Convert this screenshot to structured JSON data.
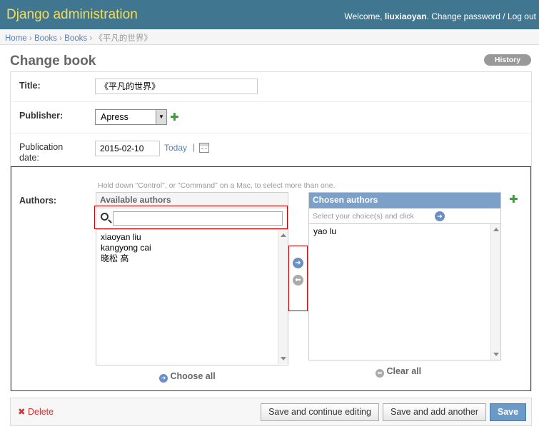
{
  "header": {
    "branding": "Django administration",
    "welcome": "Welcome, ",
    "username": "liuxiaoyan",
    "change_password": "Change password",
    "separator": " / ",
    "logout": "Log out"
  },
  "breadcrumbs": {
    "home": "Home",
    "app": "Books",
    "model": "Books",
    "current": "《平凡的世界》",
    "sep": "›"
  },
  "page": {
    "title": "Change book",
    "history": "History"
  },
  "form": {
    "title_label": "Title:",
    "title_value": "《平凡的世界》",
    "publisher_label": "Publisher:",
    "publisher_value": "Apress",
    "pubdate_label_1": "Publication",
    "pubdate_label_2": "date:",
    "pubdate_value": "2015-02-10",
    "today": "Today",
    "today_sep": "|",
    "authors_label": "Authors:",
    "help_text": "Hold down \"Control\", or \"Command\" on a Mac, to select more than one."
  },
  "available": {
    "title": "Available authors",
    "filter_value": "",
    "items": [
      "xiaoyan liu",
      "kangyong cai",
      "晓松 高"
    ],
    "choose_all": "Choose all"
  },
  "chosen": {
    "title": "Chosen authors",
    "hint": "Select your choice(s) and click",
    "items": [
      "yao lu"
    ],
    "clear_all": "Clear all"
  },
  "submit": {
    "delete": "Delete",
    "save_continue": "Save and continue editing",
    "save_add": "Save and add another",
    "save": "Save"
  },
  "colors": {
    "header_bg": "#417690",
    "branding": "#f5dd5d",
    "link": "#5b80b2",
    "chosen_header": "#7ca0c7",
    "highlight": "#cc0000"
  }
}
